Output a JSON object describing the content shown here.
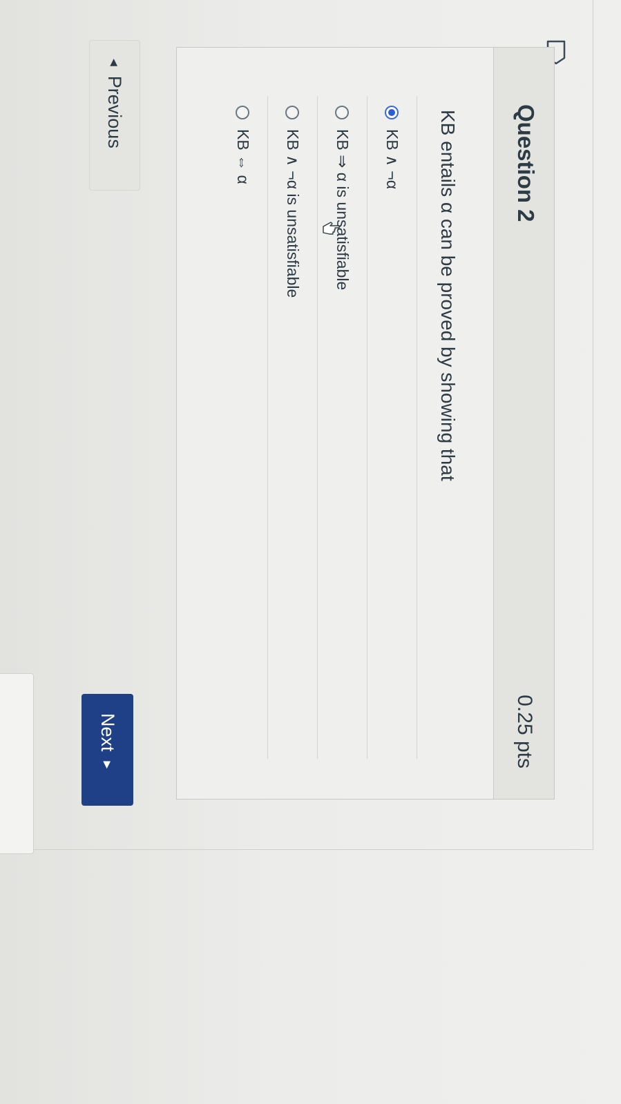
{
  "question": {
    "title": "Question 2",
    "points": "0.25 pts",
    "text": "KB entails α can be proved by showing that",
    "answers": [
      {
        "label": "KB ∧ ¬α",
        "selected": true
      },
      {
        "label": "KB ⇒ α is unsatisfiable",
        "selected": false
      },
      {
        "label": "KB ∧ ¬α is unsatisfiable",
        "selected": false
      },
      {
        "label": "KB ⇔ α",
        "selected": false
      }
    ]
  },
  "navigation": {
    "previous_label": "Previous",
    "next_label": "Next"
  },
  "icons": {
    "bookmark": "bookmark-icon",
    "cursor": "hand-cursor-icon",
    "previous_arrow": "triangle-left-icon",
    "next_arrow": "triangle-right-icon"
  },
  "colors": {
    "accent": "#1f3f86",
    "selected_radio": "#2a5fd6",
    "text": "#2d3b45"
  }
}
